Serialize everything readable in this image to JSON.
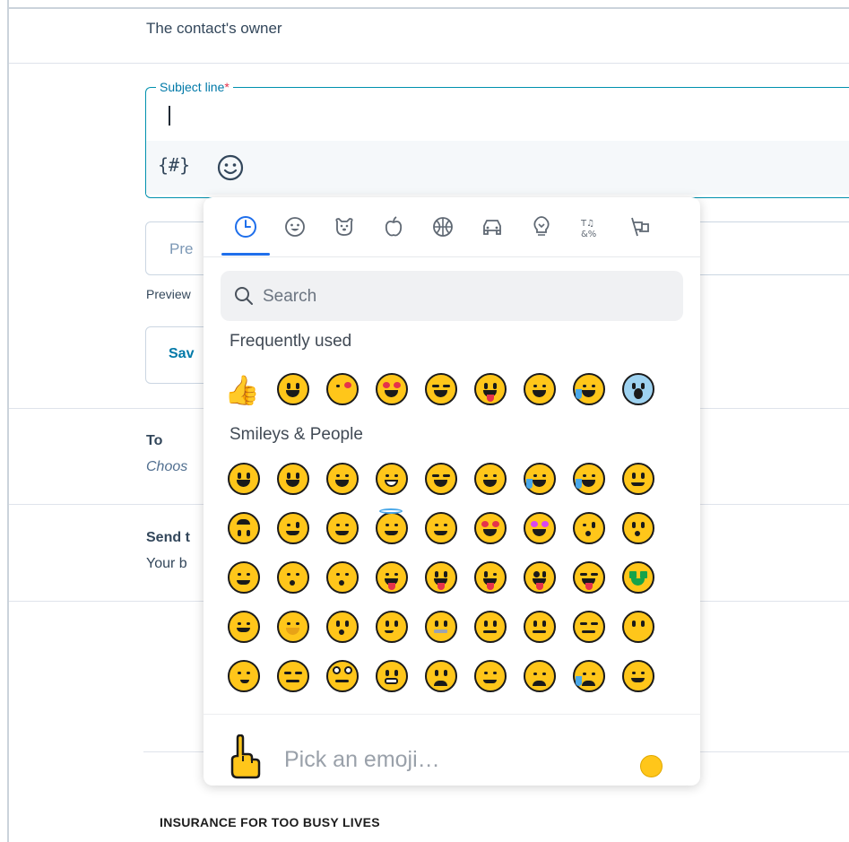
{
  "form": {
    "owner_text": "The contact's owner",
    "subject_label": "Subject line",
    "subject_required_mark": "*",
    "subject_value": "",
    "token_icon_text": "{#}",
    "preview_placeholder": "Pre",
    "preview_help": "Preview",
    "save_label": "Sav",
    "to_label": "To",
    "to_value": "Choos",
    "send_label": "Send t",
    "send_value": "Your b",
    "footer_text": "INSURANCE FOR TOO BUSY LIVES"
  },
  "picker": {
    "categories": [
      "recent-icon",
      "smileys-icon",
      "animals-icon",
      "food-icon",
      "activity-icon",
      "travel-icon",
      "objects-icon",
      "symbols-icon",
      "flags-icon"
    ],
    "active_category": "recent-icon",
    "search_placeholder": "Search",
    "sections": [
      {
        "title": "Frequently used"
      },
      {
        "title": "Smileys & People"
      }
    ],
    "frequently_used": [
      "thumbs-up",
      "smiley",
      "kissing-heart",
      "heart-eyes",
      "laughing",
      "winking-tongue",
      "sweat-smile",
      "joy",
      "scream"
    ],
    "smileys_rows": [
      [
        "grinning",
        "smiley",
        "smile",
        "grin",
        "laughing",
        "sweat-smile",
        "rofl",
        "joy",
        "slight-smile"
      ],
      [
        "upside-down",
        "wink",
        "blush",
        "innocent",
        "smiling-hearts",
        "heart-eyes",
        "star-struck",
        "kissing-heart",
        "kissing"
      ],
      [
        "relaxed",
        "kissing-closed",
        "kissing-smiling",
        "yum",
        "tongue",
        "winking-tongue",
        "zany",
        "squinting-tongue",
        "money-mouth"
      ],
      [
        "hugging",
        "hand-over-mouth",
        "shushing",
        "thinking",
        "zipper-mouth",
        "raised-eyebrow",
        "neutral",
        "expressionless",
        "no-mouth"
      ],
      [
        "smirk",
        "unamused",
        "eye-roll",
        "grimacing",
        "lying",
        "relieved",
        "pensive",
        "sleepy",
        "drooling"
      ]
    ],
    "footer_placeholder": "Pick an emoji…",
    "skin_tone_color": "#ffc61a",
    "accent_color": "#1f6feb"
  }
}
